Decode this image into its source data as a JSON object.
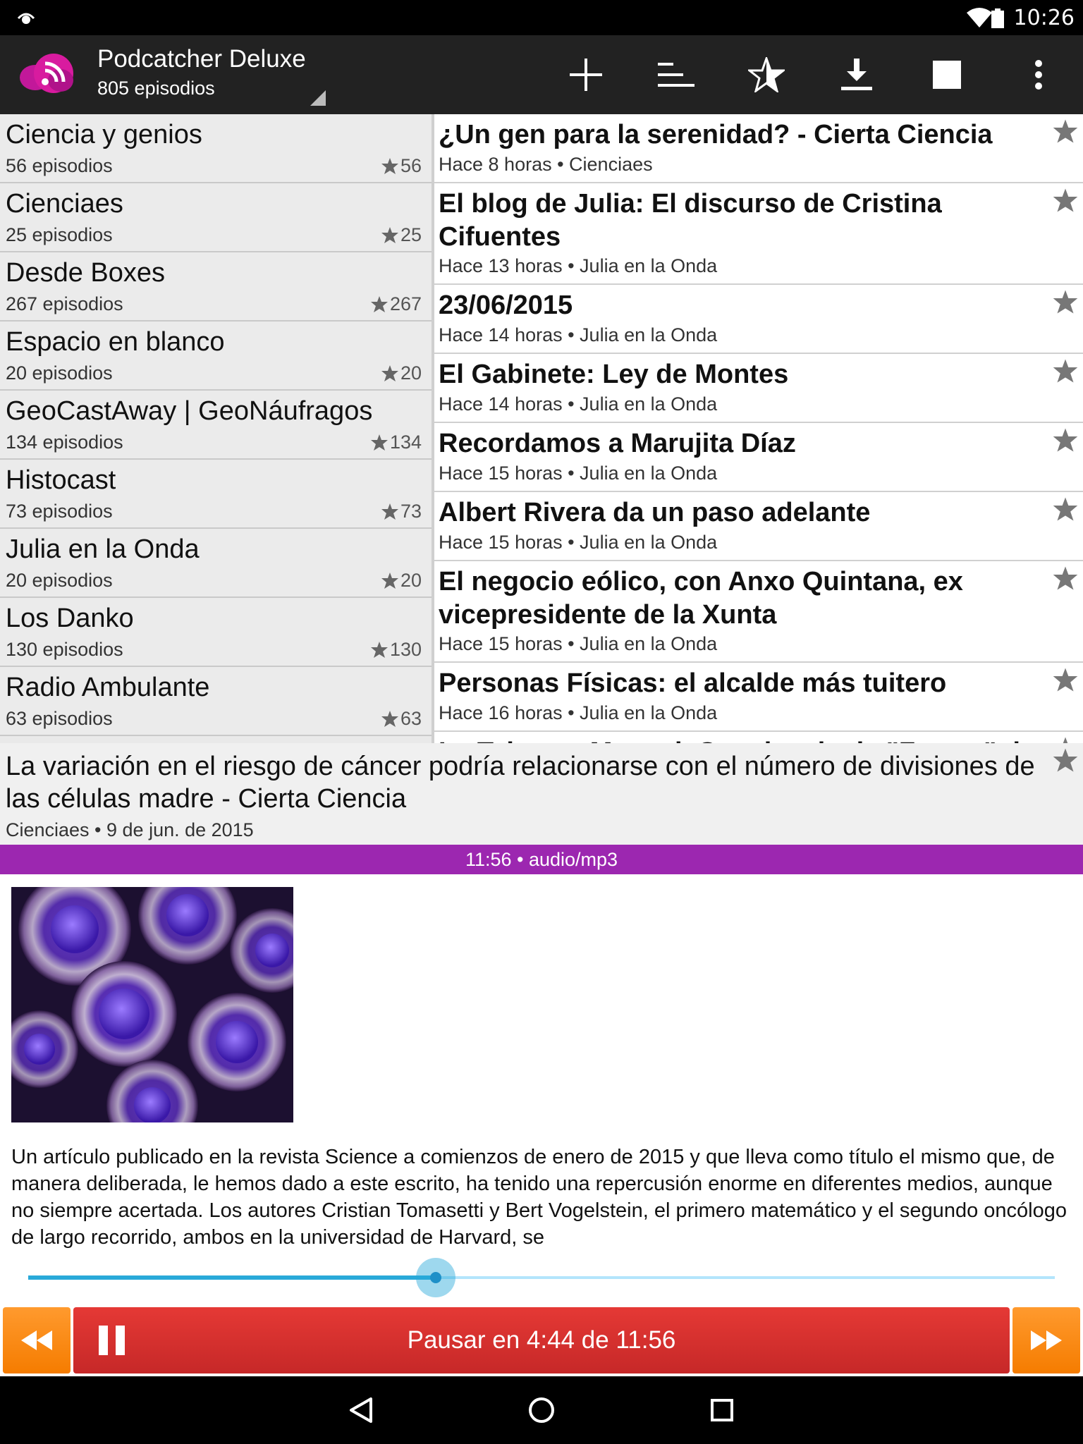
{
  "status_bar": {
    "time": "10:26"
  },
  "app": {
    "title": "Podcatcher Deluxe",
    "subtitle": "805 episodios"
  },
  "action_bar": {
    "icons": [
      "add-icon",
      "sort-icon",
      "star-filter-icon",
      "download-icon",
      "stop-icon",
      "overflow-menu-icon"
    ]
  },
  "feeds": [
    {
      "name": "Ciencia y genios",
      "count": "56 episodios",
      "stars": "56"
    },
    {
      "name": "Cienciaes",
      "count": "25 episodios",
      "stars": "25"
    },
    {
      "name": "Desde Boxes",
      "count": "267 episodios",
      "stars": "267"
    },
    {
      "name": "Espacio en blanco",
      "count": "20 episodios",
      "stars": "20"
    },
    {
      "name": "GeoCastAway | GeoNáufragos",
      "count": "134 episodios",
      "stars": "134"
    },
    {
      "name": "Histocast",
      "count": "73 episodios",
      "stars": "73"
    },
    {
      "name": "Julia en la Onda",
      "count": "20 episodios",
      "stars": "20"
    },
    {
      "name": "Los Danko",
      "count": "130 episodios",
      "stars": "130"
    },
    {
      "name": "Radio Ambulante",
      "count": "63 episodios",
      "stars": "63"
    }
  ],
  "episodes": [
    {
      "title": "¿Un gen para la serenidad? - Cierta Ciencia",
      "meta": "Hace 8 horas • Cienciaes"
    },
    {
      "title": "El blog de Julia: El discurso de Cristina Cifuentes",
      "meta": "Hace 13 horas • Julia en la Onda"
    },
    {
      "title": "23/06/2015",
      "meta": "Hace 14 horas • Julia en la Onda"
    },
    {
      "title": "El Gabinete: Ley de Montes",
      "meta": "Hace 14 horas • Julia en la Onda"
    },
    {
      "title": "Recordamos a Marujita Díaz",
      "meta": "Hace 15 horas • Julia en la Onda"
    },
    {
      "title": "Albert Rivera da un paso adelante",
      "meta": "Hace 15 horas • Julia en la Onda"
    },
    {
      "title": "El negocio eólico, con Anxo Quintana, ex vicepresidente de la Xunta",
      "meta": "Hace 15 horas • Julia en la Onda"
    },
    {
      "title": "Personas Físicas: el alcalde más tuitero",
      "meta": "Hace 16 horas • Julia en la Onda"
    },
    {
      "title": "La Tabarra: Manuel, Conciencia de \"Futuro\" de ...",
      "meta": ""
    }
  ],
  "selected_episode": {
    "title": "La variación en el riesgo de cáncer podría relacionarse con el número de divisiones de las células madre - Cierta Ciencia",
    "meta": "Cienciaes • 9 de jun. de 2015",
    "info_bar": "11:56 • audio/mp3",
    "info_bar_color": "#9c27b0"
  },
  "article": {
    "image_alt": "cells-illustration",
    "text": "Un artículo publicado en la revista Science a comienzos de enero de 2015 y que lleva como título el mismo que, de manera deliberada, le hemos dado a este escrito, ha tenido una repercusión enorme en diferentes medios, aunque no siempre acertada. Los autores Cristian Tomasetti y Bert Vogelstein, el primero matemático y el segundo oncólogo de largo recorrido, ambos en la universidad de Harvard, se"
  },
  "player": {
    "progress_fraction": 0.397,
    "main_button_label": "Pausar en 4:44 de 11:56",
    "rewind_icon": "rewind-icon",
    "forward_icon": "fast-forward-icon",
    "accent_color": "#29a9d9",
    "play_color": "#d32f2f",
    "skip_color": "#f57c00"
  },
  "nav_bar": {
    "icons": [
      "back-icon",
      "home-icon",
      "recents-icon"
    ]
  }
}
